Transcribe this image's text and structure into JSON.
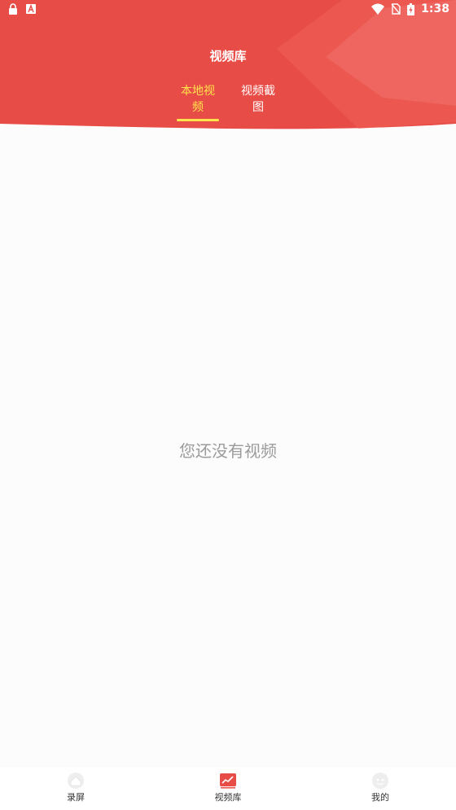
{
  "status_bar": {
    "time": "1:38",
    "left_icons": [
      "lock-icon",
      "a-badge-icon"
    ],
    "right_icons": [
      "wifi-icon",
      "no-sim-icon",
      "battery-charging-icon"
    ]
  },
  "header": {
    "title": "视频库",
    "tabs": [
      {
        "label": "本地视频",
        "active": true
      },
      {
        "label": "视频截图",
        "active": false
      }
    ],
    "colors": {
      "background": "#e84a44",
      "active_tab": "#ffe34d"
    }
  },
  "main": {
    "empty_message": "您还没有视频"
  },
  "bottom_nav": {
    "items": [
      {
        "label": "录屏",
        "icon": "home-icon",
        "active": false
      },
      {
        "label": "视频库",
        "icon": "chart-icon",
        "active": true
      },
      {
        "label": "我的",
        "icon": "profile-face-icon",
        "active": false
      }
    ]
  }
}
